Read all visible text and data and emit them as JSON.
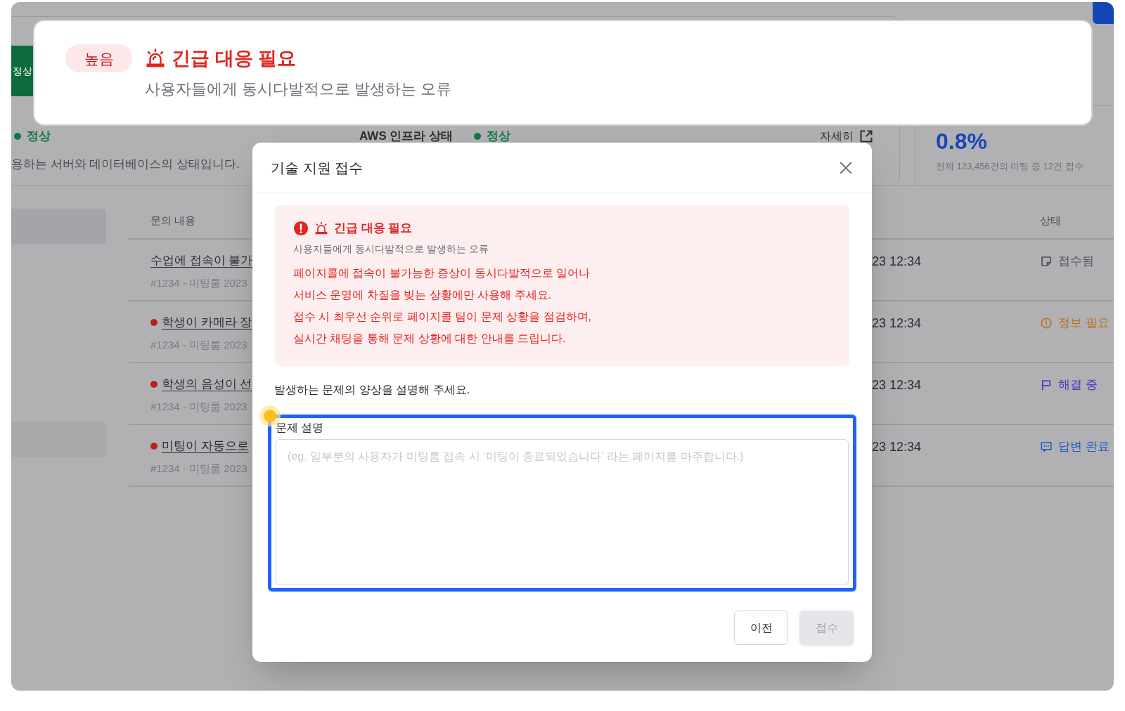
{
  "background": {
    "status_tab": {
      "label": "정상"
    },
    "service": {
      "status": "정상",
      "description": "용하는 서버와 데이터베이스의 상태입니다."
    },
    "aws": {
      "label": "AWS 인프라 상태",
      "status": "정상"
    },
    "details_link": "자세히",
    "rate": {
      "value": "0.8%",
      "caption": "전체 123,456건의 미팅 중 12건 접수"
    },
    "table": {
      "columns": [
        "문의 내용",
        "상태"
      ],
      "rows": [
        {
          "title": "수업에 접속이 불가",
          "urgent": false,
          "meta": "#1234 - 미팅룸 2023",
          "time": "23 12:34",
          "status": {
            "kind": "received",
            "label": "접수됨"
          }
        },
        {
          "title": "학생이 카메라 장",
          "urgent": true,
          "meta": "#1234 - 미팅룸 2023",
          "time": "23 12:34",
          "status": {
            "kind": "info_needed",
            "label": "정보 필요"
          }
        },
        {
          "title": "학생의 음성이 선",
          "urgent": true,
          "meta": "#1234 - 미팅룸 2023",
          "time": "23 12:34",
          "status": {
            "kind": "in_progress",
            "label": "해결 중"
          }
        },
        {
          "title": "미팅이 자동으로",
          "urgent": true,
          "meta": "#1234 - 미팅룸 2023",
          "time": "23 12:34",
          "status": {
            "kind": "answered",
            "label": "답변 완료"
          }
        }
      ]
    }
  },
  "banner": {
    "badge": "높음",
    "title": "긴급 대응 필요",
    "subtitle": "사용자들에게 동시다발적으로 발생하는 오류"
  },
  "dialog": {
    "title": "기술 지원 접수",
    "alert": {
      "title": "긴급 대응 필요",
      "subtitle": "사용자들에게 동시다발적으로 발생하는 오류",
      "lines": [
        "페이지콜에 접속이 불가능한 증상이 동시다발적으로 일어나",
        "서비스 운영에 차질을 빚는 상황에만 사용해 주세요.",
        "접수 시 최우선 순위로 페이지콜 팀이 문제 상황을 점검하며,",
        "실시간 채팅을 통해 문제 상황에 대한 안내를 드립니다."
      ]
    },
    "prompt": "발생하는 문제의 양상을 설명해 주세요.",
    "field": {
      "label": "문제 설명",
      "placeholder": "(eg. 일부분의 사용자가 미팅룸 접속 시 ‘미팅이 종료되었습니다’ 라는 페이지를 마주합니다.)"
    },
    "buttons": [
      {
        "label": "이전",
        "disabled": false
      },
      {
        "label": "접수",
        "disabled": true
      }
    ]
  }
}
